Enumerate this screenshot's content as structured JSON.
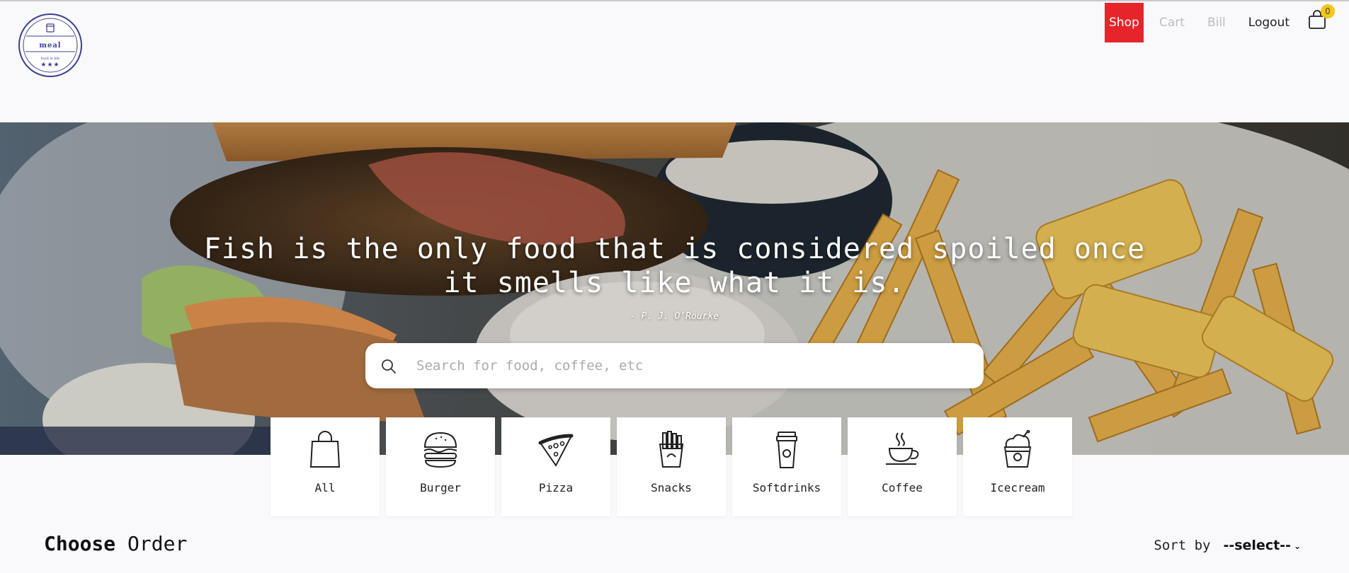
{
  "brand": {
    "name": "meal",
    "tagline": "food is life",
    "stars": "★★★"
  },
  "nav": {
    "items": [
      {
        "label": "Shop",
        "active": true
      },
      {
        "label": "Cart",
        "active": false
      },
      {
        "label": "Bill",
        "active": false
      },
      {
        "label": "Logout",
        "active": false
      }
    ],
    "cart_count": "0"
  },
  "hero": {
    "quote": "Fish is the only food that is considered spoiled once it smells like what it is.",
    "author": "- P. J. O'Rourke"
  },
  "search": {
    "placeholder": "Search for food, coffee, etc",
    "value": ""
  },
  "categories": [
    {
      "label": "All",
      "icon": "shopping-bag-icon"
    },
    {
      "label": "Burger",
      "icon": "burger-icon"
    },
    {
      "label": "Pizza",
      "icon": "pizza-icon"
    },
    {
      "label": "Snacks",
      "icon": "fries-icon"
    },
    {
      "label": "Softdrinks",
      "icon": "cup-icon"
    },
    {
      "label": "Coffee",
      "icon": "coffee-icon"
    },
    {
      "label": "Icecream",
      "icon": "icecream-icon"
    }
  ],
  "section": {
    "title_bold": "Choose",
    "title_rest": " Order"
  },
  "sort": {
    "label": "Sort by",
    "selected": "--select--"
  },
  "colors": {
    "accent": "#e5252a",
    "badge": "#f5c518",
    "brand": "#3b3f8f"
  }
}
